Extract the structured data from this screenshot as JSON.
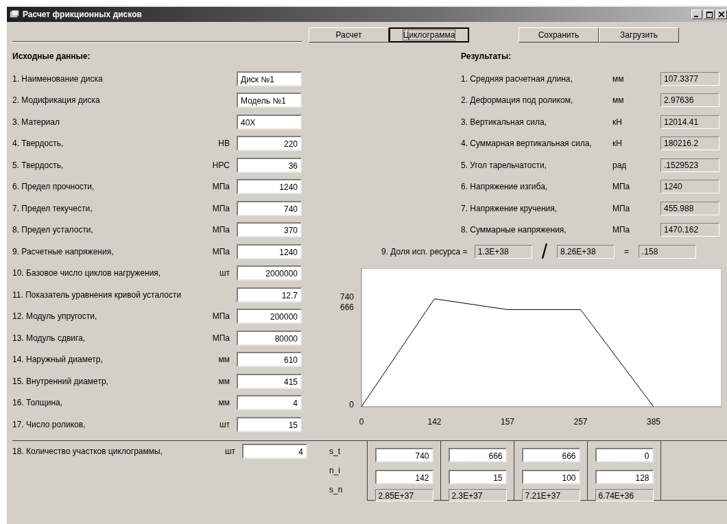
{
  "window": {
    "title": "Расчет фрикционных дисков"
  },
  "toolbar": {
    "left": [
      {
        "label": "Расчет",
        "focused": false
      },
      {
        "label": "Циклограмма",
        "focused": true
      }
    ],
    "right": [
      {
        "label": "Сохранить",
        "focused": false
      },
      {
        "label": "Загрузить",
        "focused": false
      }
    ]
  },
  "inputs": {
    "heading": "Исходные данные:",
    "rows": [
      {
        "label": "1. Наименование диска",
        "value": "Диск №1",
        "kind": "text"
      },
      {
        "label": "2. Модификация диска",
        "value": "Модель №1",
        "kind": "text"
      },
      {
        "label": "3. Материал",
        "value": "40Х",
        "kind": "text"
      },
      {
        "label": "4. Твердость,",
        "unit": "НВ",
        "value": "220",
        "kind": "number"
      },
      {
        "label": "5. Твердость,",
        "unit": "НРС",
        "value": "36",
        "kind": "number"
      },
      {
        "label": "6. Предел прочности,",
        "unit": "МПа",
        "value": "1240",
        "kind": "number"
      },
      {
        "label": "7. Предел текучести,",
        "unit": "МПа",
        "value": "740",
        "kind": "number"
      },
      {
        "label": "8. Предел усталости,",
        "unit": "МПа",
        "value": "370",
        "kind": "number"
      },
      {
        "label": "9. Расчетные напряжения,",
        "unit": "МПа",
        "value": "1240",
        "kind": "number"
      },
      {
        "label": "10. Базовое число циклов нагружения,",
        "unit": "шт",
        "value": "2000000",
        "kind": "number"
      },
      {
        "label": "11. Показатель уравнения кривой усталости",
        "value": "12.7",
        "kind": "number"
      },
      {
        "label": "12. Модуль упругости,",
        "unit": "МПа",
        "value": "200000",
        "kind": "number"
      },
      {
        "label": "13. Модуль сдвига,",
        "unit": "МПа",
        "value": "80000",
        "kind": "number"
      },
      {
        "label": "14. Наружный диаметр,",
        "unit": "мм",
        "value": "610",
        "kind": "number"
      },
      {
        "label": "15. Внутренний диаметр,",
        "unit": "мм",
        "value": "415",
        "kind": "number"
      },
      {
        "label": "16. Толщина,",
        "unit": "мм",
        "value": "4",
        "kind": "number"
      },
      {
        "label": "17. Число роликов,",
        "unit": "шт",
        "value": "15",
        "kind": "number"
      }
    ]
  },
  "results": {
    "heading": "Результаты:",
    "rows": [
      {
        "label": "1. Средняя расчетная длина,",
        "unit": "мм",
        "value": "107.3377"
      },
      {
        "label": "2. Деформация под роликом,",
        "unit": "мм",
        "value": "2.97636"
      },
      {
        "label": "3. Вертикальная сила,",
        "unit": "кН",
        "value": "12014.41"
      },
      {
        "label": "4. Суммарная вертикальная сила,",
        "unit": "кН",
        "value": "180216.2"
      },
      {
        "label": "5. Угол тарельчатости,",
        "unit": "рад",
        "value": ".1529523"
      },
      {
        "label": "6. Напряжение изгиба,",
        "unit": "МПа",
        "value": "1240"
      },
      {
        "label": "7. Напряжение кручения,",
        "unit": "МПа",
        "value": "455.988"
      },
      {
        "label": "8. Суммарные напряжения,",
        "unit": "МПа",
        "value": "1470.162"
      }
    ]
  },
  "resource": {
    "label": "9. Доля исп. ресурса =",
    "numerator": "1.3E+38",
    "divider": "/",
    "denominator": "8.26E+38",
    "equals": "=",
    "result": ".158"
  },
  "chart_data": {
    "type": "line",
    "categories": [
      "0",
      "142",
      "157",
      "257",
      "385"
    ],
    "series": [
      {
        "color": "#000000",
        "values": [
          0,
          740,
          666,
          666,
          0
        ]
      }
    ],
    "ylim": [
      0,
      950
    ],
    "yticks": [
      0,
      666,
      740
    ]
  },
  "cyclogram": {
    "label": "18. Количество участков циклограммы,",
    "unit": "шт",
    "value": "4",
    "row_labels": [
      "s_t",
      "n_i",
      "s_n"
    ],
    "columns": [
      {
        "s_t": "740",
        "n_i": "142",
        "s_n": "2.85E+37"
      },
      {
        "s_t": "666",
        "n_i": "15",
        "s_n": "2.3E+37"
      },
      {
        "s_t": "666",
        "n_i": "100",
        "s_n": "7.21E+37"
      },
      {
        "s_t": "0",
        "n_i": "128",
        "s_n": "6.74E+36"
      }
    ]
  }
}
